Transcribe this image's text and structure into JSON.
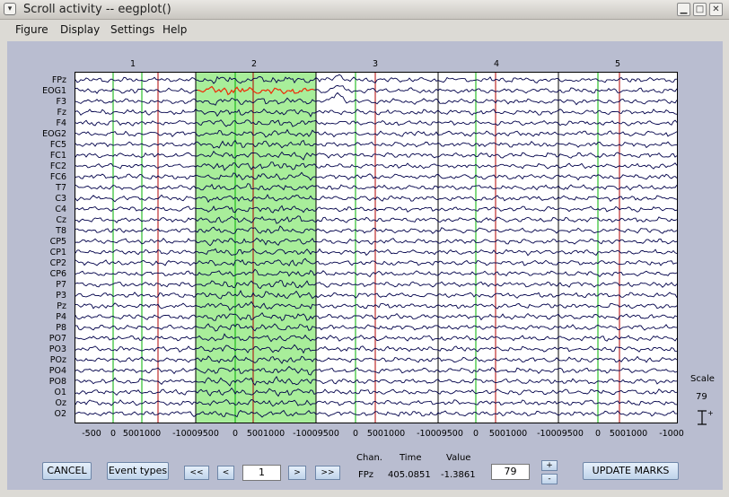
{
  "window": {
    "title": "Scroll activity -- eegplot()"
  },
  "menu": [
    "Figure",
    "Display",
    "Settings",
    "Help"
  ],
  "channels": [
    "FPz",
    "EOG1",
    "F3",
    "Fz",
    "F4",
    "EOG2",
    "FC5",
    "FC1",
    "FC2",
    "FC6",
    "T7",
    "C3",
    "C4",
    "Cz",
    "T8",
    "CP5",
    "CP1",
    "CP2",
    "CP6",
    "P7",
    "P3",
    "Pz",
    "P4",
    "P8",
    "PO7",
    "PO3",
    "POz",
    "PO4",
    "PO8",
    "O1",
    "Oz",
    "O2"
  ],
  "epochs": [
    "1",
    "2",
    "3",
    "4",
    "5"
  ],
  "time_ticks": [
    "-500",
    "0",
    "5001000",
    "-10009500",
    "0",
    "5001000",
    "-10009500",
    "0",
    "5001000",
    "-10009500",
    "0",
    "5001000",
    "-10009500",
    "0",
    "5001000",
    "-1000"
  ],
  "controls": {
    "cancel": "CANCEL",
    "event_types": "Event types",
    "prev_prev": "<<",
    "prev": "<",
    "epoch_value": "1",
    "next": ">",
    "next_next": ">>",
    "scale_value": "79",
    "plus": "+",
    "minus": "-",
    "update_marks": "UPDATE MARKS"
  },
  "readout": {
    "chan_label": "Chan.",
    "time_label": "Time",
    "value_label": "Value",
    "chan": "FPz",
    "time": "405.0851",
    "value": "-1.3861"
  },
  "scale": {
    "label": "Scale",
    "value": "79"
  },
  "colors": {
    "background": "#b9bdd0",
    "selection": "#a8ee9a",
    "trace": "#00004a",
    "marked_trace": "#ff2a00",
    "event_green": "#00b000",
    "event_red": "#b00000"
  }
}
